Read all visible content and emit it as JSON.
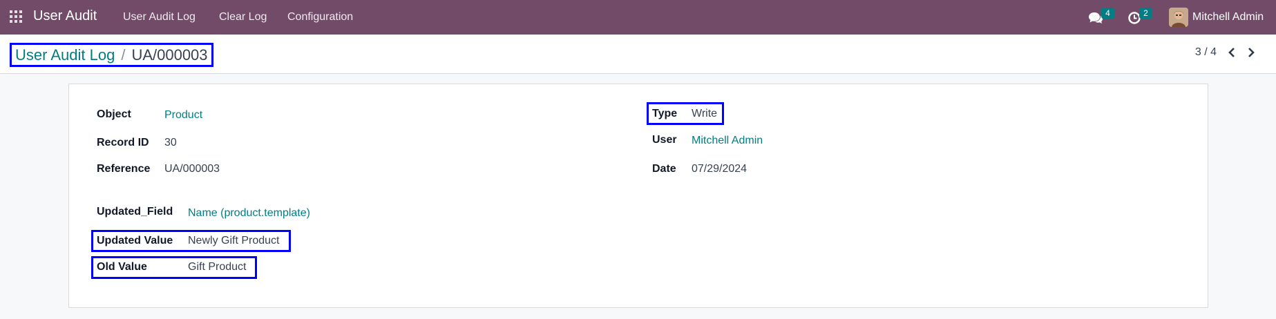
{
  "navbar": {
    "brand": "User Audit",
    "menu": [
      "User Audit Log",
      "Clear Log",
      "Configuration"
    ],
    "messages_count": "4",
    "activities_count": "2",
    "user_name": "Mitchell Admin",
    "icons": [
      "apps-grid-icon",
      "chat-icon",
      "clock-icon",
      "avatar"
    ],
    "colors": {
      "navbar": "#714b67",
      "badge": "#017e84"
    }
  },
  "breadcrumb": {
    "parent": "User Audit Log",
    "separator": "/",
    "current": "UA/000003"
  },
  "pager": {
    "position": "3 / 4"
  },
  "record": {
    "object_label": "Object",
    "object_value": "Product",
    "record_id_label": "Record ID",
    "record_id_value": "30",
    "reference_label": "Reference",
    "reference_value": "UA/000003",
    "type_label": "Type",
    "type_value": "Write",
    "user_label": "User",
    "user_value": "Mitchell Admin",
    "date_label": "Date",
    "date_value": "07/29/2024",
    "updated_field_label": "Updated_Field",
    "updated_field_value": "Name (product.template)",
    "updated_value_label": "Updated Value",
    "updated_value_value": "Newly Gift Product",
    "old_value_label": "Old Value",
    "old_value_value": "Gift Product"
  },
  "colors": {
    "link": "#017e84",
    "highlight": "#0000ff"
  }
}
